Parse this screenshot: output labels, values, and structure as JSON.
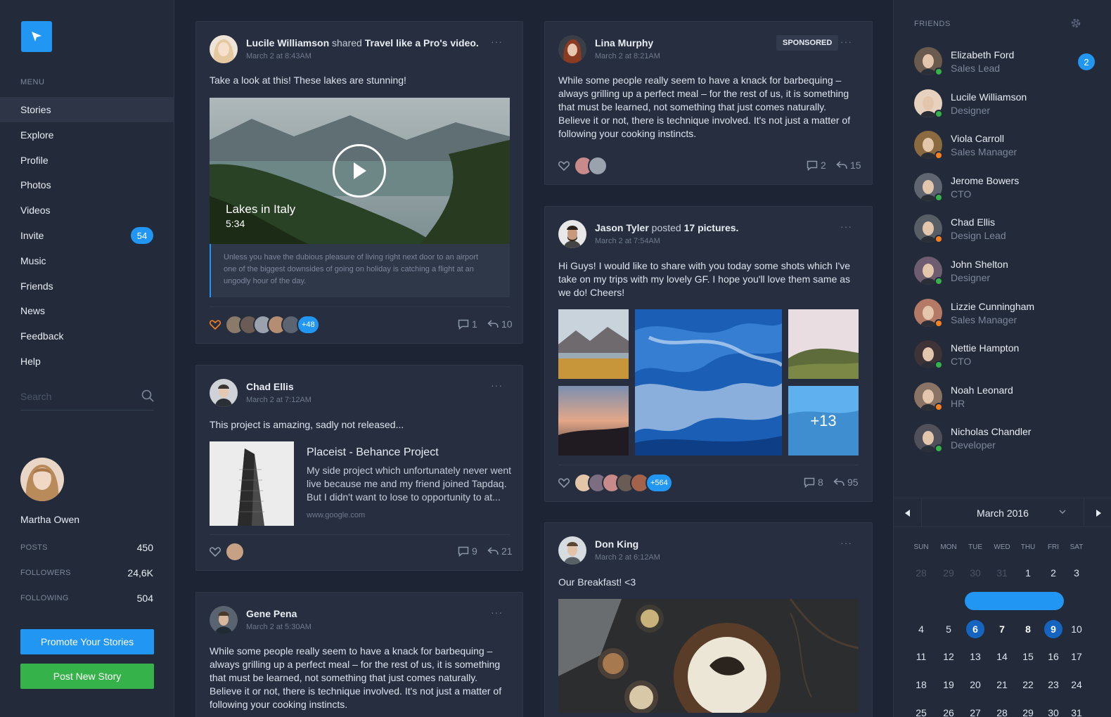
{
  "sidebar": {
    "menu_label": "MENU",
    "menu": [
      {
        "label": "Stories",
        "active": true
      },
      {
        "label": "Explore"
      },
      {
        "label": "Profile"
      },
      {
        "label": "Photos"
      },
      {
        "label": "Videos"
      },
      {
        "label": "Invite",
        "badge": "54"
      },
      {
        "label": "Music"
      },
      {
        "label": "Friends"
      },
      {
        "label": "News"
      },
      {
        "label": "Feedback"
      },
      {
        "label": "Help"
      }
    ],
    "search_placeholder": "Search",
    "profile": {
      "name": "Martha Owen",
      "stats": [
        {
          "label": "POSTS",
          "value": "450"
        },
        {
          "label": "FOLLOWERS",
          "value": "24,6K"
        },
        {
          "label": "FOLLOWING",
          "value": "504"
        }
      ]
    },
    "promote_label": "Promote Your Stories",
    "post_label": "Post New Story",
    "colors": {
      "accent": "#2196f3",
      "success": "#35b34a"
    }
  },
  "feed": {
    "post1": {
      "author": "Lucile Williamson",
      "action": "shared",
      "target": "Travel like a Pro's video.",
      "time": "March 2 at 8:43AM",
      "text": "Take a look at this! These lakes are stunning!",
      "video_title": "Lakes in Italy",
      "video_duration": "5:34",
      "quote": "Unless you have the dubious pleasure of living right next door to an airport one of the biggest downsides of going on holiday is catching a flight at an ungodly hour of the day.",
      "likers_more": "+48",
      "comments": "1",
      "shares": "10"
    },
    "post2": {
      "author": "Chad Ellis",
      "time": "March 2 at 7:12AM",
      "text": "This project is amazing, sadly not released...",
      "link_title": "Placeist - Behance Project",
      "link_desc": "My side project which unfortunately never went live because me and my friend joined Tapdaq. But I didn't want to lose to opportunity to at...",
      "link_url": "www.google.com",
      "comments": "9",
      "shares": "21"
    },
    "post3": {
      "author": "Gene Pena",
      "time": "March 2 at 5:30AM",
      "text": "While some people really seem to have a knack for barbequing – always grilling up a perfect meal – for the rest of us, it is something that must be learned, not something that just comes naturally. Believe it or not, there is technique involved. It's not just a matter of following your cooking instincts."
    },
    "post4": {
      "author": "Lina Murphy",
      "time": "March 2 at 8:21AM",
      "badge": "SPONSORED",
      "text": "While some people really seem to have a knack for barbequing – always grilling up a perfect meal – for the rest of us, it is something that must be learned, not something that just comes naturally. Believe it or not, there is technique involved. It's not just a matter of following your cooking instincts.",
      "comments": "2",
      "shares": "15"
    },
    "post5": {
      "author": "Jason Tyler",
      "action": "posted",
      "target": "17 pictures.",
      "time": "March 2 at 7:54AM",
      "text": "Hi Guys! I would like to share with you today some shots which I've take on my trips with my lovely GF. I hope you'll love them same as we do! Cheers!",
      "more_photos": "+13",
      "likers_more": "+564",
      "comments": "8",
      "shares": "95"
    },
    "post6": {
      "author": "Don King",
      "time": "March 2 at 6:12AM",
      "text": "Our Breakfast! <3"
    },
    "more_glyph": "···"
  },
  "friends": {
    "label": "FRIENDS",
    "list": [
      {
        "name": "Elizabeth Ford",
        "role": "Sales Lead",
        "status": "online",
        "badge": "2"
      },
      {
        "name": "Lucile Williamson",
        "role": "Designer",
        "status": "online"
      },
      {
        "name": "Viola Carroll",
        "role": "Sales Manager",
        "status": "away"
      },
      {
        "name": "Jerome Bowers",
        "role": "CTO",
        "status": "online"
      },
      {
        "name": "Chad Ellis",
        "role": "Design Lead",
        "status": "away"
      },
      {
        "name": "John Shelton",
        "role": "Designer",
        "status": "online"
      },
      {
        "name": "Lizzie Cunningham",
        "role": "Sales Manager",
        "status": "away"
      },
      {
        "name": "Nettie Hampton",
        "role": "CTO",
        "status": "online"
      },
      {
        "name": "Noah Leonard",
        "role": "HR",
        "status": "away"
      },
      {
        "name": "Nicholas Chandler",
        "role": "Developer",
        "status": "online"
      }
    ],
    "status_colors": {
      "online": "#35b34a",
      "away": "#f5821f"
    }
  },
  "calendar": {
    "month": "March 2016",
    "weekdays": [
      "SUN",
      "MON",
      "TUE",
      "WED",
      "THU",
      "FRI",
      "SAT"
    ],
    "weeks": [
      [
        "28",
        "29",
        "30",
        "31",
        "1",
        "2",
        "3"
      ],
      [
        "4",
        "5",
        "6",
        "7",
        "8",
        "9",
        "10"
      ],
      [
        "11",
        "12",
        "13",
        "14",
        "15",
        "16",
        "17"
      ],
      [
        "18",
        "19",
        "20",
        "21",
        "22",
        "23",
        "24"
      ],
      [
        "25",
        "26",
        "27",
        "28",
        "29",
        "30",
        "31"
      ]
    ],
    "muted": [
      "28",
      "29",
      "30",
      "31"
    ],
    "selected_range": [
      "6",
      "9"
    ]
  }
}
